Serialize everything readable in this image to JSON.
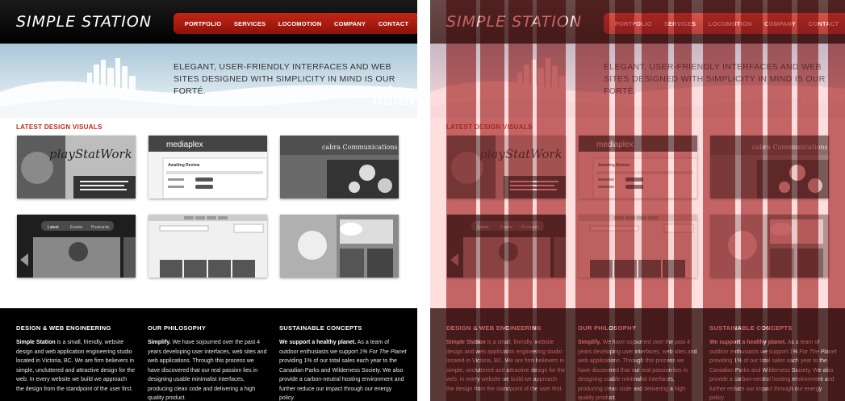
{
  "site": {
    "logo": "SIMPLE STATION",
    "nav": [
      "PORTFOLIO",
      "SERVICES",
      "LOCOMOTION",
      "COMPANY",
      "CONTACT"
    ],
    "tagline": "ELEGANT, USER-FRIENDLY INTERFACES AND WEB SITES DESIGNED WITH SIMPLICITY IN MIND IS OUR FORTÉ.",
    "latest_title": "LATEST DESIGN VISUALS",
    "thumbs": [
      {
        "name": "playstation-work",
        "label": "playStatWork"
      },
      {
        "name": "mediaplex",
        "label": "mediaplex",
        "sub": "Awaiting Review"
      },
      {
        "name": "cabra-communications",
        "label": "cabra Communications"
      },
      {
        "name": "latest-tabs",
        "tabs": [
          "Latest",
          "Events",
          "Postcards"
        ]
      },
      {
        "name": "search-screen",
        "label": ""
      },
      {
        "name": "comic-collage",
        "label": ""
      }
    ],
    "footer": [
      {
        "title": "DESIGN & WEB ENGINEERING",
        "bold": "Simple Station",
        "text": " is a small, friendly, website design and web application engineering studio located in Victoria, BC. We are firm believers in simple, uncluttered and attractive design for the web. In every website we build we approach the design from the standpoint of the user first."
      },
      {
        "title": "OUR PHILOSOPHY",
        "bold": "Simplify.",
        "text": " We have sojourned over the past 4 years developing user interfaces, web sites and web applications. Through this process we have discovered that our real passion lies in designing usable minimalist interfaces, producing clean code and delivering a high quality product."
      },
      {
        "title": "SUSTAINABLE CONCEPTS",
        "bold": "We support a healthy planet.",
        "text": " As a team of outdoor enthusiasts we support ",
        "em": "1% For The Planet",
        "text2": " providing 1% of our total sales each year to the Canadian Parks and Wilderness Society. We also provide a carbon-neutral hosting environment and further reduce our impact through our energy policy."
      }
    ]
  },
  "colors": {
    "accent": "#c0281a",
    "nav": "#b01f10",
    "overlay_stripe": "#8b0000"
  }
}
